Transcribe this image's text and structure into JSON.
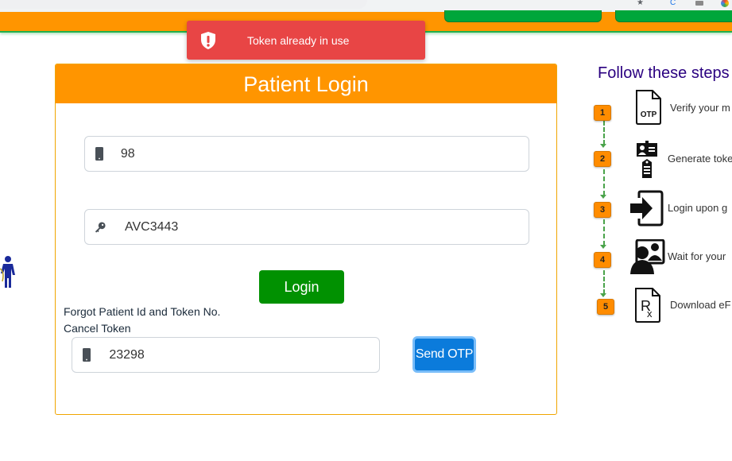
{
  "toast": {
    "message": "Token already in use",
    "icon": "shield-exclamation-icon",
    "color": "#e84545"
  },
  "card": {
    "title": "Patient Login",
    "mobile_field": {
      "value": "98",
      "icon": "mobile-phone-icon"
    },
    "token_field": {
      "value": "AVC3443",
      "icon": "key-icon"
    },
    "login_label": "Login",
    "forgot_link": "Forgot Patient Id and Token No.",
    "cancel_link": "Cancel Token",
    "cancel_field": {
      "value": "23298",
      "icon": "mobile-phone-icon"
    },
    "send_otp_label": "Send OTP"
  },
  "steps": {
    "title": "Follow these steps",
    "items": [
      {
        "number": "1",
        "icon": "otp-document-icon",
        "text": "Verify your m"
      },
      {
        "number": "2",
        "icon": "id-card-token-icon",
        "text": "Generate toke"
      },
      {
        "number": "3",
        "icon": "login-enter-icon",
        "text": "Login upon g"
      },
      {
        "number": "4",
        "icon": "video-consult-icon",
        "text": "Wait for your"
      },
      {
        "number": "5",
        "icon": "prescription-rx-icon",
        "text": "Download eF"
      }
    ]
  },
  "colors": {
    "header_orange": "#ff9500",
    "header_green_border": "#22b04b",
    "login_green": "#019101",
    "otp_blue": "#0b7bdb",
    "steps_title": "#2a0080",
    "step_badge": "#ff8c00"
  }
}
